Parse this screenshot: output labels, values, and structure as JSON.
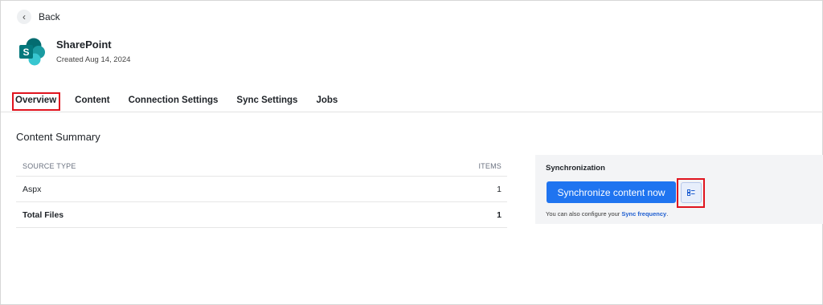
{
  "nav": {
    "back_label": "Back",
    "back_icon": "chevron-left-icon"
  },
  "app": {
    "name": "SharePoint",
    "created": "Created Aug 14, 2024",
    "logo_icon": "sharepoint-logo",
    "logo_letter": "S",
    "colors": {
      "dark": "#036c70",
      "mid": "#1a9ba1",
      "light": "#37c6d0"
    }
  },
  "tabs": [
    {
      "label": "Overview",
      "active": true
    },
    {
      "label": "Content",
      "active": false
    },
    {
      "label": "Connection Settings",
      "active": false
    },
    {
      "label": "Sync Settings",
      "active": false
    },
    {
      "label": "Jobs",
      "active": false
    }
  ],
  "summary": {
    "title": "Content Summary",
    "columns": {
      "source": "SOURCE TYPE",
      "items": "ITEMS"
    },
    "rows": [
      {
        "source": "Aspx",
        "items": "1"
      }
    ],
    "total": {
      "source": "Total Files",
      "items": "1"
    }
  },
  "sync": {
    "title": "Synchronization",
    "button_label": "Synchronize content now",
    "settings_icon": "sync-options-icon",
    "note_prefix": "You can also configure your ",
    "note_link": "Sync frequency",
    "note_suffix": "."
  },
  "colors": {
    "accent": "#1f74f0",
    "link": "#1f5fd1",
    "highlight": "#e0141e",
    "panel": "#f3f4f6"
  }
}
